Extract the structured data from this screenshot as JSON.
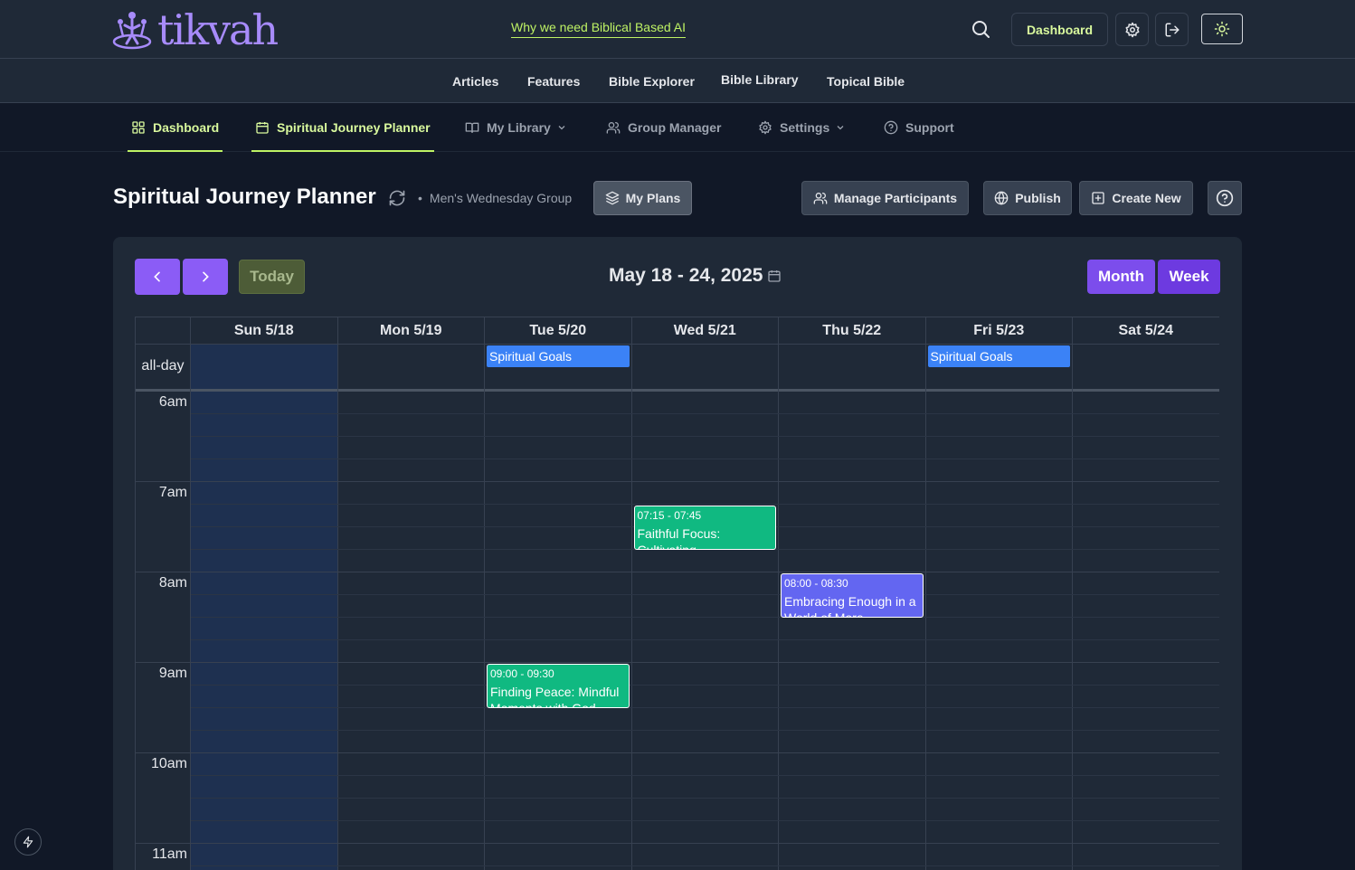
{
  "brand": {
    "name": "tikvah",
    "tagline": "Why we need Biblical Based AI"
  },
  "header": {
    "dashboard_label": "Dashboard",
    "icons": [
      "search-icon",
      "gear-icon",
      "logout-icon",
      "sun-icon"
    ]
  },
  "nav2": [
    "Articles",
    "Features",
    "Bible Explorer",
    "Bible Library",
    "Topical Bible"
  ],
  "tabs": [
    {
      "label": "Dashboard",
      "icon": "grid-icon",
      "active": true
    },
    {
      "label": "Spiritual Journey Planner",
      "icon": "calendar-icon",
      "active": true
    },
    {
      "label": "My Library",
      "icon": "book-icon",
      "dropdown": true
    },
    {
      "label": "Group Manager",
      "icon": "users-icon"
    },
    {
      "label": "Settings",
      "icon": "gear-icon",
      "dropdown": true
    },
    {
      "label": "Support",
      "icon": "help-circle-icon"
    }
  ],
  "page": {
    "title": "Spiritual Journey Planner",
    "group": "Men's Wednesday Group",
    "my_plans": "My Plans",
    "manage": "Manage Participants",
    "publish": "Publish",
    "create": "Create New"
  },
  "calendar": {
    "today_label": "Today",
    "range": "May 18 - 24, 2025",
    "month_label": "Month",
    "week_label": "Week",
    "allday_label": "all-day",
    "days": [
      "Sun 5/18",
      "Mon 5/19",
      "Tue 5/20",
      "Wed 5/21",
      "Thu 5/22",
      "Fri 5/23",
      "Sat 5/24"
    ],
    "hours": [
      "6am",
      "7am",
      "8am",
      "9am",
      "10am",
      "11am"
    ],
    "allday_events": [
      {
        "day": 2,
        "title": "Spiritual Goals"
      },
      {
        "day": 5,
        "title": "Spiritual Goals"
      }
    ],
    "events": [
      {
        "day": 3,
        "time": "07:15 - 07:45",
        "title": "Faithful Focus: Cultivating",
        "color": "#10b981",
        "start": 7.25,
        "end": 7.75
      },
      {
        "day": 4,
        "time": "08:00 - 08:30",
        "title": "Embracing Enough in a World of More",
        "color": "#6366f1",
        "start": 8.0,
        "end": 8.5
      },
      {
        "day": 2,
        "time": "09:00 - 09:30",
        "title": "Finding Peace: Mindful Moments with God",
        "color": "#10b981",
        "start": 9.0,
        "end": 9.5
      }
    ]
  }
}
